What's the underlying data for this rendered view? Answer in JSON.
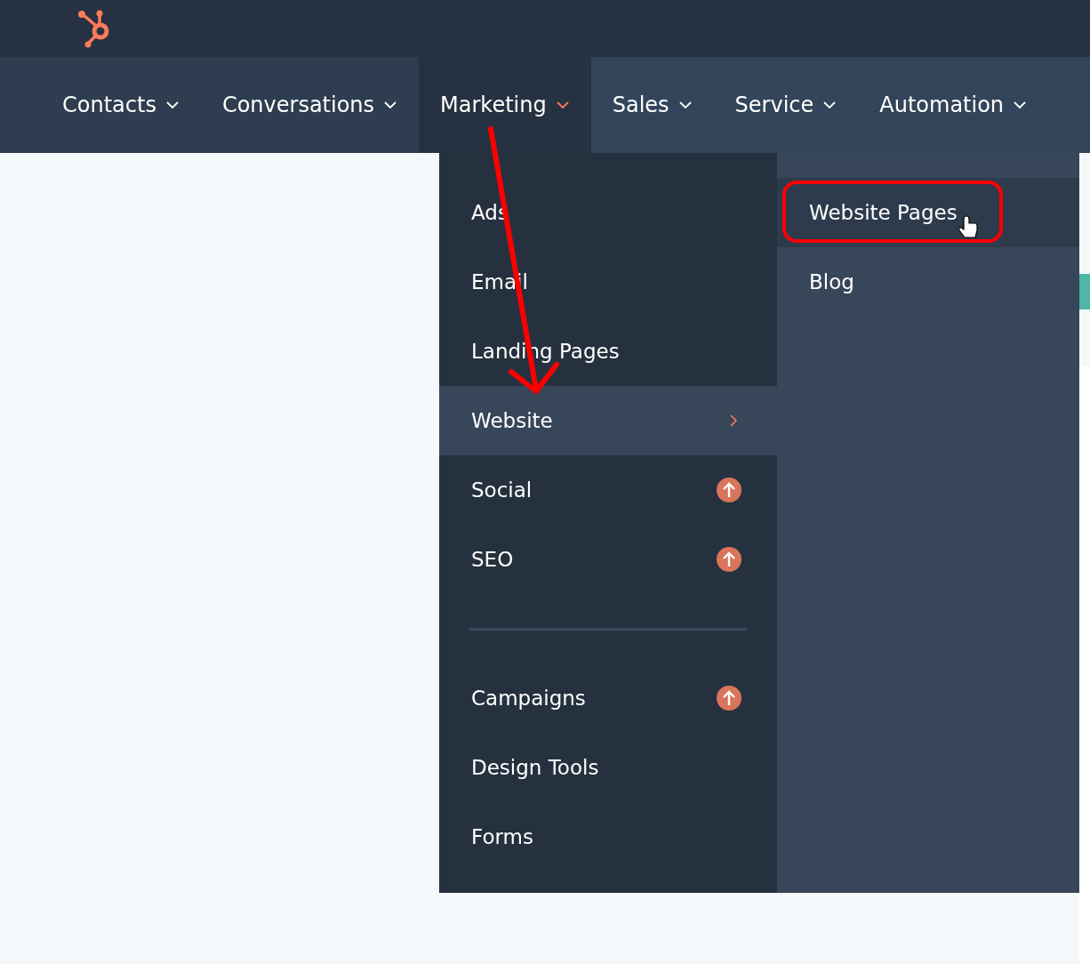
{
  "nav": [
    {
      "label": "Contacts",
      "selected": false
    },
    {
      "label": "Conversations",
      "selected": false
    },
    {
      "label": "Marketing",
      "selected": true
    },
    {
      "label": "Sales",
      "selected": false
    },
    {
      "label": "Service",
      "selected": false
    },
    {
      "label": "Automation",
      "selected": false
    }
  ],
  "menu": [
    {
      "kind": "link",
      "label": "Ads",
      "selected": false
    },
    {
      "kind": "link",
      "label": "Email",
      "selected": false
    },
    {
      "kind": "link",
      "label": "Landing Pages",
      "selected": false
    },
    {
      "kind": "submenu",
      "label": "Website",
      "selected": true
    },
    {
      "kind": "upgrade",
      "label": "Social",
      "selected": false
    },
    {
      "kind": "upgrade",
      "label": "SEO",
      "selected": false
    },
    {
      "kind": "divider"
    },
    {
      "kind": "upgrade",
      "label": "Campaigns",
      "selected": false
    },
    {
      "kind": "link",
      "label": "Design Tools",
      "selected": false
    },
    {
      "kind": "link",
      "label": "Forms",
      "selected": false
    }
  ],
  "submenu": [
    {
      "label": "Website Pages",
      "selected": true
    },
    {
      "label": "Blog",
      "selected": false
    }
  ]
}
